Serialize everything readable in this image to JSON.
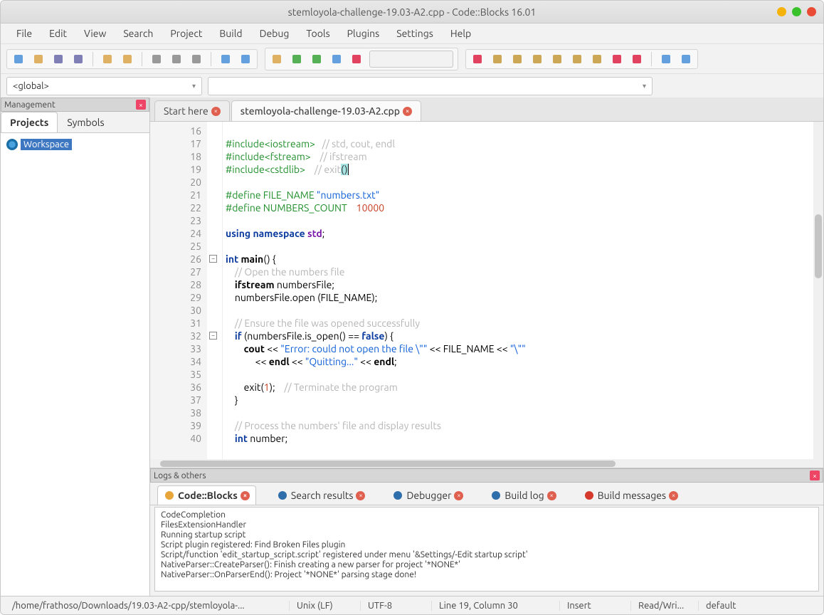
{
  "title": "stemloyola-challenge-19.03-A2.cpp - Code::Blocks 16.01",
  "menu": [
    "File",
    "Edit",
    "View",
    "Search",
    "Project",
    "Build",
    "Debug",
    "Tools",
    "Plugins",
    "Settings",
    "Help"
  ],
  "scope": {
    "left": "<global>",
    "right": ""
  },
  "management": {
    "title": "Management",
    "tabs": [
      "Projects",
      "Symbols"
    ],
    "active_tab": "Projects",
    "workspace_label": "Workspace"
  },
  "editor": {
    "tabs": [
      {
        "label": "Start here",
        "active": false
      },
      {
        "label": "stemloyola-challenge-19.03-A2.cpp",
        "active": true
      }
    ],
    "first_line": 16,
    "lines": [
      {
        "n": 16,
        "raw": ""
      },
      {
        "n": 17,
        "raw": "pp:#include<iostream>|pl:   |cm:// std, cout, endl"
      },
      {
        "n": 18,
        "raw": "pp:#include<fstream>|pl:    |cm:// ifstream"
      },
      {
        "n": 19,
        "raw": "pp:#include<cstdlib>|pl:    |cm:// exit|hl:()",
        "cursor": true
      },
      {
        "n": 20,
        "raw": ""
      },
      {
        "n": 21,
        "raw": "pp:#define FILE_NAME |str:\"numbers.txt\""
      },
      {
        "n": 22,
        "raw": "pp:#define NUMBERS_COUNT    |num:10000"
      },
      {
        "n": 23,
        "raw": ""
      },
      {
        "n": 24,
        "raw": "kw:using |kw:namespace |tp:std|pl:;"
      },
      {
        "n": 25,
        "raw": ""
      },
      {
        "n": 26,
        "raw": "kw:int |idb:main|pl:() {"
      },
      {
        "n": 27,
        "raw": "pl:    |cm:// Open the numbers file"
      },
      {
        "n": 28,
        "raw": "pl:    |idb:ifstream |pl:numbersFile;"
      },
      {
        "n": 29,
        "raw": "pl:    numbersFile.open (FILE_NAME);"
      },
      {
        "n": 30,
        "raw": ""
      },
      {
        "n": 31,
        "raw": "pl:    |cm:// Ensure the file was opened successfully"
      },
      {
        "n": 32,
        "raw": "pl:    |kw:if |pl:(numbersFile.is_open() == |kw:false|pl:) {"
      },
      {
        "n": 33,
        "raw": "pl:        |idb:cout |pl:<< |str:\"Error: could not open the file \\\"\"|pl: << FILE_NAME << |str:\"\\\"\""
      },
      {
        "n": 34,
        "raw": "pl:             << |idb:endl |pl:<< |str:\"Quitting...\"|pl: << |idb:endl|pl:;"
      },
      {
        "n": 35,
        "raw": ""
      },
      {
        "n": 36,
        "raw": "pl:        exit(|num:1|pl:);    |cm:// Terminate the program"
      },
      {
        "n": 37,
        "raw": "pl:    }"
      },
      {
        "n": 38,
        "raw": ""
      },
      {
        "n": 39,
        "raw": "pl:    |cm:// Process the numbers' file and display results"
      },
      {
        "n": 40,
        "raw": "pl:    |kw:int |pl:number;"
      }
    ],
    "fold_markers": [
      {
        "line": 26,
        "sym": "−"
      },
      {
        "line": 32,
        "sym": "−"
      }
    ]
  },
  "logs": {
    "title": "Logs & others",
    "tabs": [
      {
        "label": "Code::Blocks",
        "icon": "doc",
        "color": "#e7a53a"
      },
      {
        "label": "Search results",
        "icon": "search",
        "color": "#2e6fab"
      },
      {
        "label": "Debugger",
        "icon": "bug",
        "color": "#2e6fab"
      },
      {
        "label": "Build log",
        "icon": "gear",
        "color": "#2e6fab"
      },
      {
        "label": "Build messages",
        "icon": "flag",
        "color": "#d63a2c"
      }
    ],
    "active_tab": 0,
    "lines": [
      "CodeCompletion",
      "FilesExtensionHandler",
      "Running startup script",
      "Script plugin registered: Find Broken Files plugin",
      "Script/function 'edit_startup_script.script' registered under menu '&Settings/-Edit startup script'",
      "NativeParser::CreateParser(): Finish creating a new parser for project '*NONE*'",
      "NativeParser::OnParserEnd(): Project '*NONE*' parsing stage done!"
    ]
  },
  "status": {
    "path": "/home/frathoso/Downloads/19.03-A2-cpp/stemloyola-...",
    "eol": "Unix (LF)",
    "encoding": "UTF-8",
    "position": "Line 19, Column 30",
    "insert": "Insert",
    "rw": "Read/Wri...",
    "profile": "default"
  },
  "icons": {
    "toolbar1": [
      "new-file",
      "open-file",
      "save",
      "save-all",
      "",
      "undo",
      "redo",
      "",
      "cut",
      "copy",
      "paste",
      "",
      "find",
      "replace"
    ],
    "toolbar2": [
      "build",
      "run",
      "build-run",
      "rebuild",
      "stop",
      "target-combo"
    ],
    "toolbar3": [
      "debug-run",
      "run-to-cursor",
      "next-line",
      "step-into",
      "step-out",
      "next-instr",
      "step-instr",
      "break",
      "stop-debug",
      "",
      "debug-windows",
      "debug-info"
    ]
  }
}
